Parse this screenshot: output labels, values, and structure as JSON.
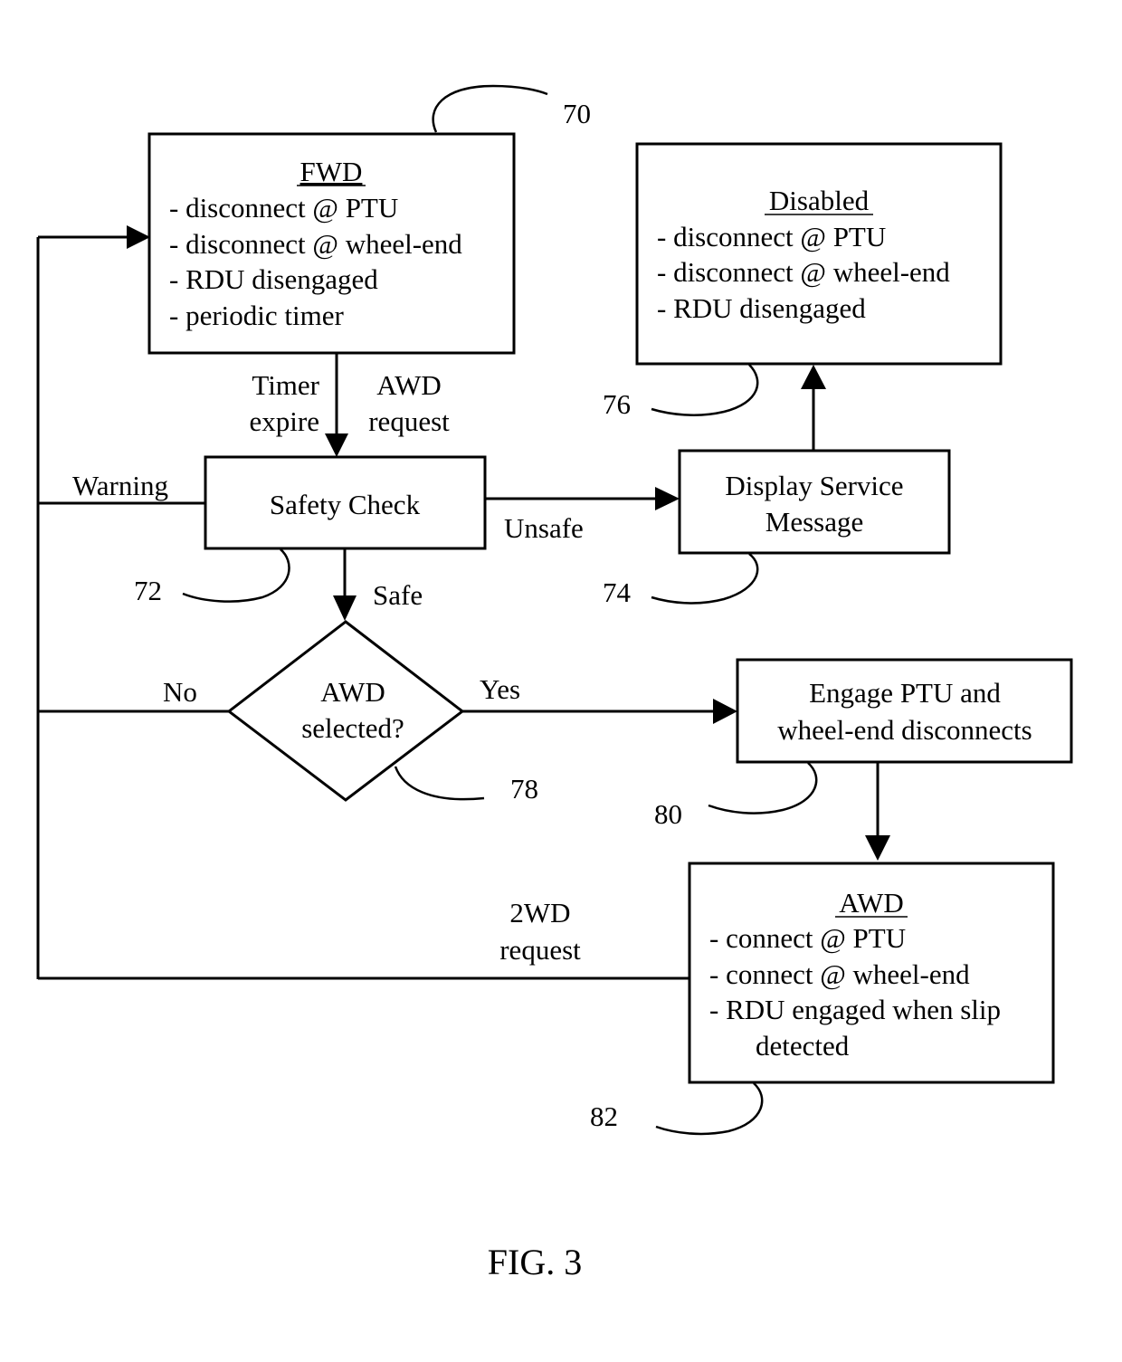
{
  "figure": {
    "caption": "FIG. 3"
  },
  "nodes": {
    "fwd": {
      "ref": "70",
      "title": "FWD",
      "lines": [
        "- disconnect @ PTU",
        "- disconnect @ wheel-end",
        "- RDU disengaged",
        "- periodic timer"
      ]
    },
    "disabled": {
      "ref": "76",
      "title": "Disabled",
      "lines": [
        "- disconnect @ PTU",
        "- disconnect @ wheel-end",
        "- RDU disengaged"
      ]
    },
    "safety_check": {
      "ref": "72",
      "label": "Safety Check"
    },
    "display_service": {
      "ref": "74",
      "lines": [
        "Display Service",
        "Message"
      ]
    },
    "awd_selected": {
      "ref": "78",
      "lines": [
        "AWD",
        "selected?"
      ]
    },
    "engage": {
      "ref": "80",
      "lines": [
        "Engage PTU and",
        "wheel-end disconnects"
      ]
    },
    "awd": {
      "ref": "82",
      "title": "AWD",
      "lines": [
        "- connect @ PTU",
        "- connect @ wheel-end",
        "- RDU engaged when slip",
        "detected"
      ]
    }
  },
  "edges": {
    "timer_expire": [
      "Timer",
      "expire"
    ],
    "awd_request": [
      "AWD",
      "request"
    ],
    "warning": "Warning",
    "unsafe": "Unsafe",
    "safe": "Safe",
    "no": "No",
    "yes": "Yes",
    "twowd_request": [
      "2WD",
      "request"
    ]
  }
}
